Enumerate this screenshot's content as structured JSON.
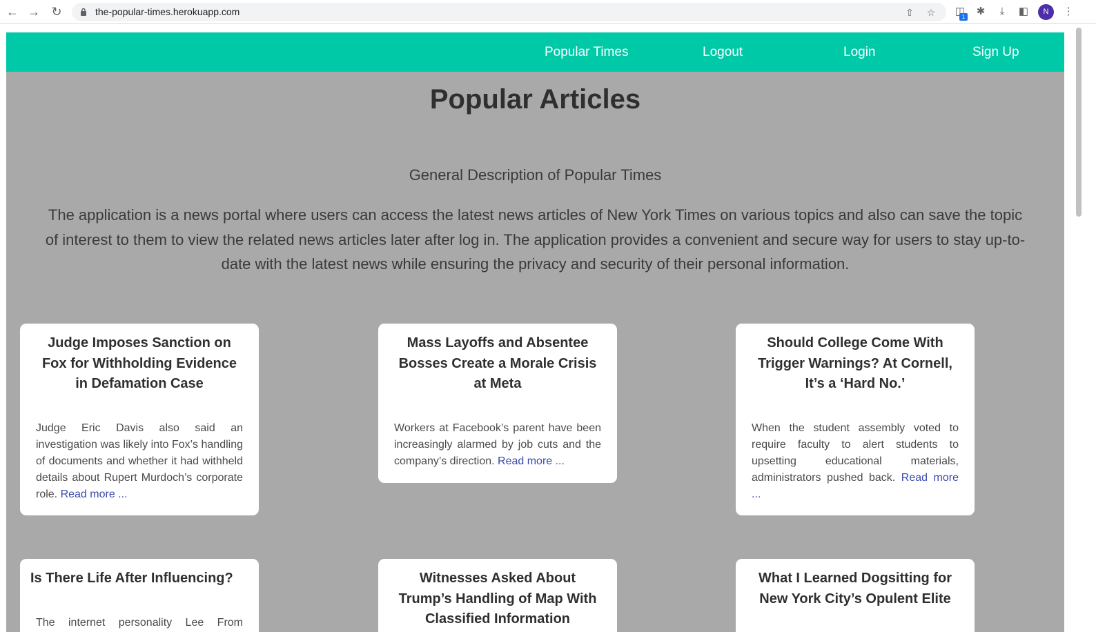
{
  "browser": {
    "url": "the-popular-times.herokuapp.com",
    "extension_badge": "1",
    "profile_initial": "N"
  },
  "navbar": {
    "links": [
      {
        "label": "Popular Times"
      },
      {
        "label": "Logout"
      },
      {
        "label": "Login"
      },
      {
        "label": "Sign Up"
      }
    ]
  },
  "page": {
    "title": "Popular Articles",
    "description_heading": "General Description of Popular Times",
    "description": "The application is a news portal where users can access the latest news articles of New York Times on various topics and also can save the topic of interest to them to view the related news articles later after log in. The application provides a convenient and secure way for users to stay up-to-date with the latest news while ensuring the privacy and security of their personal information."
  },
  "articles": [
    {
      "title": "Judge Imposes Sanction on Fox for Withholding Evidence in Defamation Case",
      "summary": "Judge Eric Davis also said an investigation was likely into Fox’s handling of documents and whether it had withheld details about Rupert Murdoch’s corporate role.",
      "read_more": "Read more ..."
    },
    {
      "title": "Mass Layoffs and Absentee Bosses Create a Morale Crisis at Meta",
      "summary": "Workers at Facebook’s parent have been increasingly alarmed by job cuts and the company’s direction.",
      "read_more": "Read more ..."
    },
    {
      "title": "Should College Come With Trigger Warnings? At Cornell, It’s a ‘Hard No.’",
      "summary": "When the student assembly voted to require faculty to alert students to upsetting educational materials, administrators pushed back.",
      "read_more": "Read more ..."
    },
    {
      "title": "Is There Life After Influencing?",
      "summary": "The internet personality Lee From",
      "read_more": ""
    },
    {
      "title": "Witnesses Asked About Trump’s Handling of Map With Classified Information",
      "summary": "",
      "read_more": ""
    },
    {
      "title": "What I Learned Dogsitting for New York City’s Opulent Elite",
      "summary": "",
      "read_more": ""
    }
  ],
  "colors": {
    "navbar": "#00c9a7",
    "background": "#a9a9a9",
    "link": "#3949ab"
  }
}
